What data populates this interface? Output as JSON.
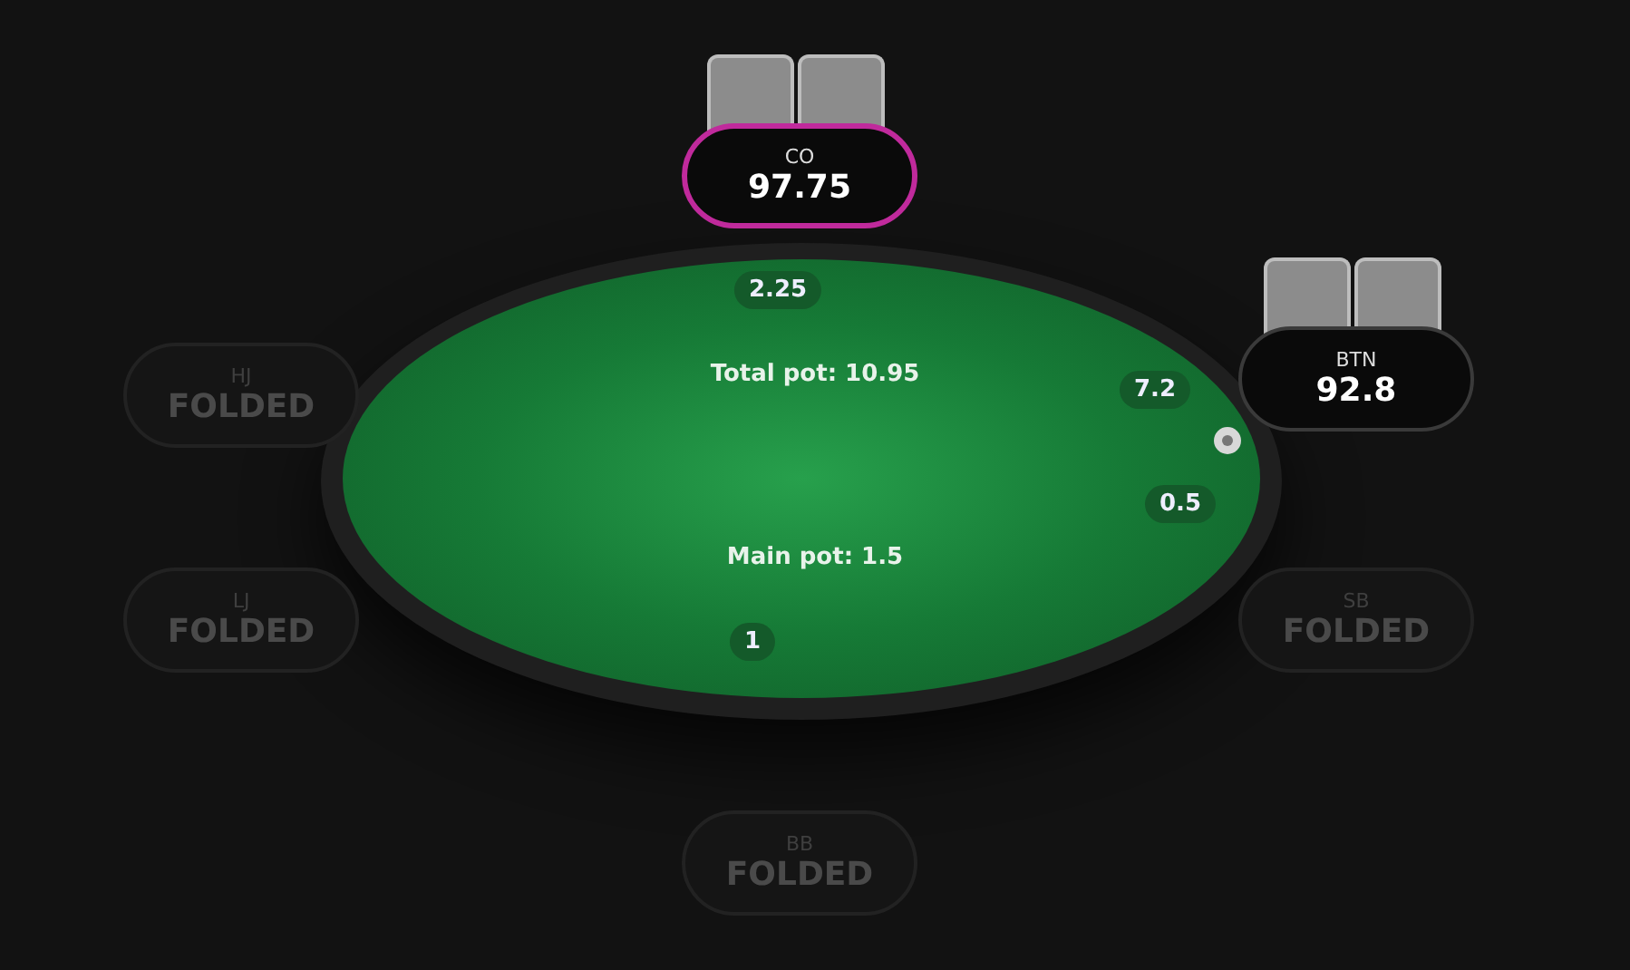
{
  "table": {
    "total_pot": "Total pot: 10.95",
    "main_pot": "Main pot: 1.5",
    "dealer_button": true
  },
  "seats": [
    {
      "position": "CO",
      "stack": "97.75",
      "kind": "active",
      "highlighted": true,
      "has_cards": true
    },
    {
      "position": "BTN",
      "stack": "92.8",
      "kind": "active",
      "highlighted": false,
      "has_cards": true
    },
    {
      "position": "HJ",
      "stack": "FOLDED",
      "kind": "folded",
      "highlighted": false,
      "has_cards": false
    },
    {
      "position": "LJ",
      "stack": "FOLDED",
      "kind": "folded",
      "highlighted": false,
      "has_cards": false
    },
    {
      "position": "SB",
      "stack": "FOLDED",
      "kind": "folded",
      "highlighted": false,
      "has_cards": false
    },
    {
      "position": "BB",
      "stack": "FOLDED",
      "kind": "folded",
      "highlighted": false,
      "has_cards": false
    }
  ],
  "bets": [
    {
      "amount": "2.25"
    },
    {
      "amount": "7.2"
    },
    {
      "amount": "0.5"
    },
    {
      "amount": "1"
    }
  ]
}
